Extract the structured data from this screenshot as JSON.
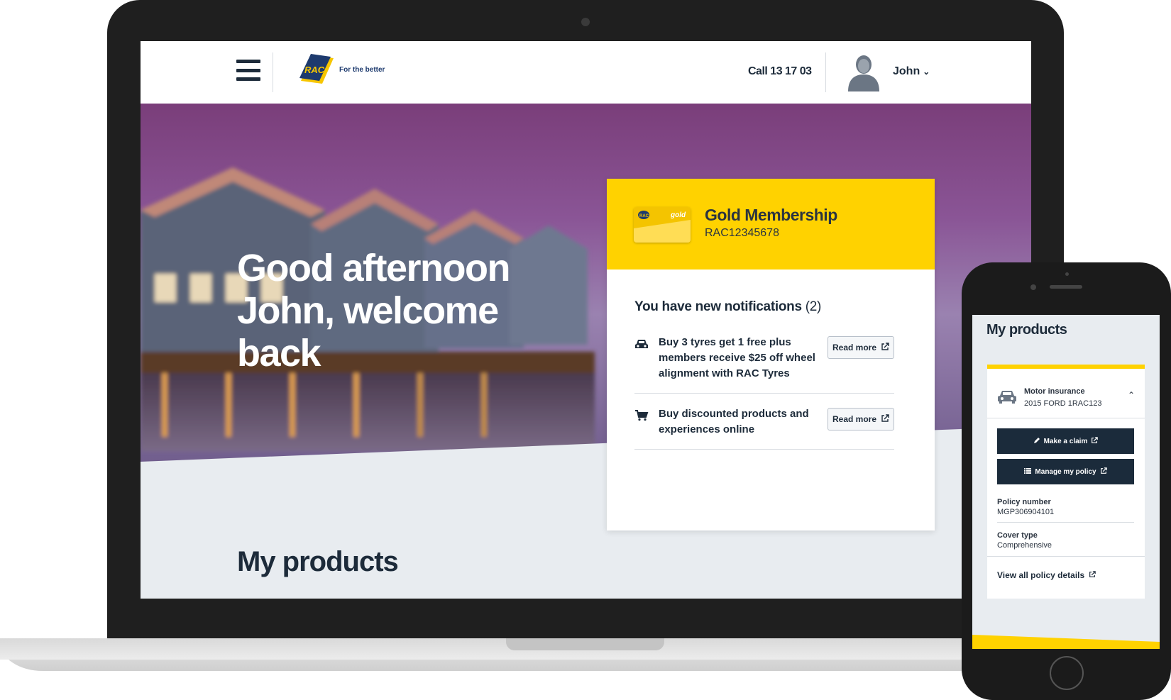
{
  "header": {
    "logo_text": "RAC",
    "tagline": "For the better",
    "phone": "Call 13 17 03",
    "user_name": "John"
  },
  "hero": {
    "greeting_line1": "Good afternoon",
    "greeting_line2": "John, welcome",
    "greeting_line3": "back"
  },
  "membership": {
    "card_logo": "RAC",
    "card_tier": "gold",
    "title": "Gold Membership",
    "number": "RAC12345678"
  },
  "notifications": {
    "heading": "You have new notifications",
    "count": "(2)",
    "items": [
      {
        "icon": "car-icon",
        "text": "Buy 3 tyres get 1 free plus members receive $25 off wheel alignment with RAC Tyres",
        "button": "Read more"
      },
      {
        "icon": "cart-icon",
        "text": "Buy discounted products and experiences online",
        "button": "Read more"
      }
    ]
  },
  "products": {
    "heading": "My products"
  },
  "phone": {
    "title": "My products",
    "product_type": "Motor insurance",
    "vehicle": "2015 FORD 1RAC123",
    "make_claim": "Make a claim",
    "manage_policy": "Manage my policy",
    "policy_number_label": "Policy number",
    "policy_number": "MGP306904101",
    "cover_type_label": "Cover type",
    "cover_type": "Comprehensive",
    "view_all": "View all policy details"
  },
  "colors": {
    "brand_yellow": "#ffd200",
    "brand_navy": "#1b2b3b",
    "page_bg": "#e8ecf0"
  }
}
